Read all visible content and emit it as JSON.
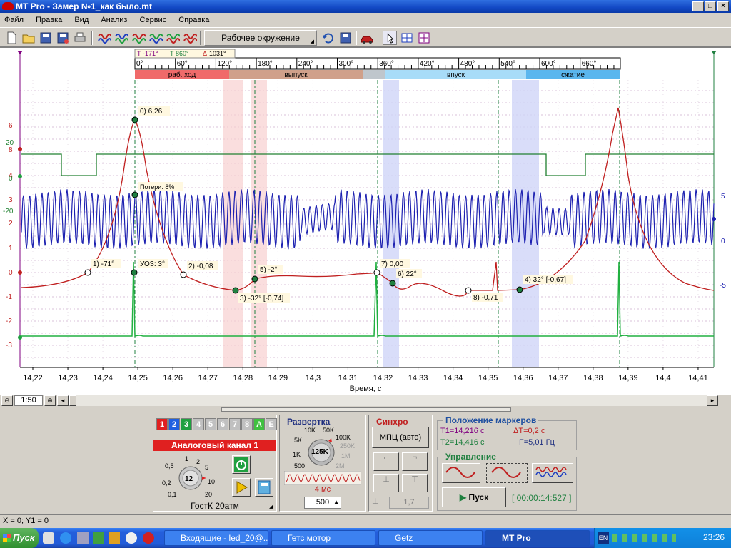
{
  "window": {
    "title": "MT Pro - Замер №1_как было.mt",
    "min": "_",
    "max": "□",
    "close": "×"
  },
  "menu": [
    "Файл",
    "Правка",
    "Вид",
    "Анализ",
    "Сервис",
    "Справка"
  ],
  "toolbar": {
    "environment": "Рабочее окружение"
  },
  "plot": {
    "marker_labels": {
      "t1": "-171°",
      "t2": "860°",
      "delta": "1031°"
    },
    "degree_ticks": [
      "0°",
      "60°",
      "120°",
      "180°",
      "240°",
      "300°",
      "360°",
      "420°",
      "480°",
      "540°",
      "600°",
      "660°"
    ],
    "phases": [
      {
        "label": "раб. ход",
        "color": "#f06a6a"
      },
      {
        "label": "выпуск",
        "color": "#d0a08a"
      },
      {
        "label": "",
        "color": "#bfc6cc"
      },
      {
        "label": "впуск",
        "color": "#a8dcf8"
      },
      {
        "label": "сжатие",
        "color": "#5ab6ee"
      }
    ],
    "left_axis_labels": [
      "6",
      "20",
      "8",
      "4",
      "0",
      "3",
      "-20",
      "2",
      "1",
      "0",
      "-1",
      "-2",
      "-3"
    ],
    "right_axis_labels": [
      "5",
      "0",
      "-5"
    ],
    "x_ticks": [
      "14,22",
      "14,23",
      "14,24",
      "14,25",
      "14,26",
      "14,27",
      "14,28",
      "14,29",
      "14,3",
      "14,31",
      "14,32",
      "14,33",
      "14,34",
      "14,35",
      "14,36",
      "14,37",
      "14,38",
      "14,39",
      "14,4",
      "14,41"
    ],
    "x_axis_label": "Время, с",
    "annotations": [
      "0) 6,26",
      "Потери: 8%",
      "1) -71°",
      "УОЗ: 3°",
      "2) -0,08",
      "5) -2°",
      "3) -32° [-0,74]",
      "7) 0,00",
      "6) 22°",
      "8) -0,71",
      "4) 32° [-0,67]"
    ]
  },
  "scroll": {
    "zoom": "1:50"
  },
  "channel_panel": {
    "tabs": [
      {
        "label": "1",
        "color": "#e02020"
      },
      {
        "label": "2",
        "color": "#2060e0"
      },
      {
        "label": "3",
        "color": "#20a040"
      },
      {
        "label": "4",
        "color": "#c0c0c0"
      },
      {
        "label": "5",
        "color": "#c0c0c0"
      },
      {
        "label": "6",
        "color": "#c0c0c0"
      },
      {
        "label": "7",
        "color": "#c0c0c0"
      },
      {
        "label": "8",
        "color": "#c0c0c0"
      },
      {
        "label": "A",
        "color": "#40c040"
      },
      {
        "label": "E",
        "color": "#c0c0c0"
      }
    ],
    "title": "Аналоговый канал 1",
    "knob_value": "12",
    "knob_scale": [
      "0,5",
      "1",
      "2",
      "5",
      "0,2",
      "10",
      "0,1",
      "20"
    ],
    "sensor": "ГостК 20атм"
  },
  "sweep": {
    "title": "Развертка",
    "knob_value": "125K",
    "scale": [
      "10K",
      "50K",
      "100K",
      "250K",
      "5K",
      "1M",
      "1K",
      "2M",
      "500"
    ],
    "time": "4 мс",
    "count": "500"
  },
  "sync": {
    "title": "Синхро",
    "mode": "МПЦ (авто)",
    "level": "1,7"
  },
  "markers": {
    "title": "Положение маркеров",
    "t1": "T1=14,216 с",
    "t2": "T2=14,416 с",
    "dt": "ΔT=0,2 с",
    "f": "F=5,01 Гц"
  },
  "control": {
    "title": "Управление",
    "start": "Пуск",
    "timer": "[ 00:00:14:527 ]"
  },
  "status": "X = 0; Y1 = 0",
  "taskbar": {
    "start": "Пуск",
    "tasks": [
      "Входящие - led_20@...",
      "Гетс мотор",
      "Getz",
      "MT Pro"
    ],
    "lang": "EN",
    "clock": "23:26"
  }
}
